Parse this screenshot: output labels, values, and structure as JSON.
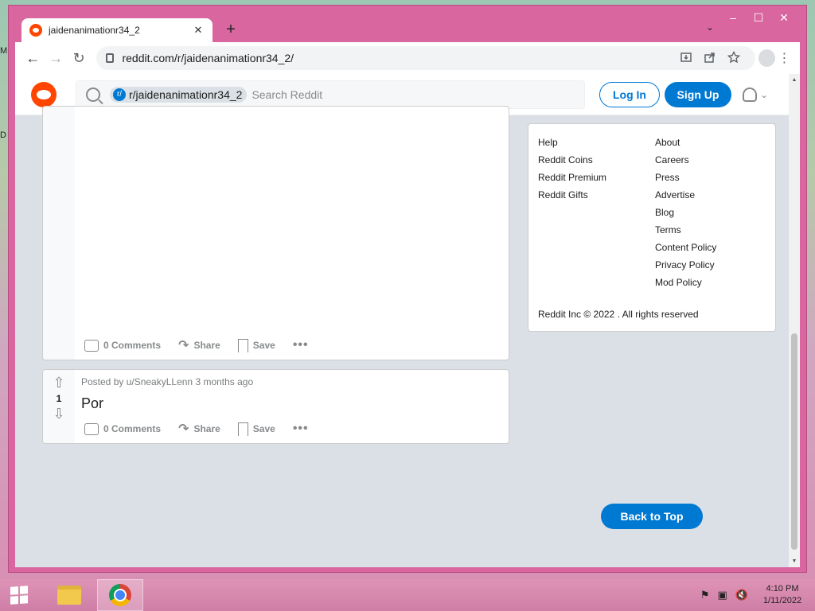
{
  "desktop": {
    "glyph1": "M",
    "glyph2": "D"
  },
  "window": {
    "minimize": "–",
    "maximize": "☐",
    "close": "✕"
  },
  "tab": {
    "title": "jaidenanimationr34_2",
    "close": "✕",
    "new_tab": "+",
    "tab_menu": "⌄"
  },
  "toolbar": {
    "back": "←",
    "forward": "→",
    "reload": "↻",
    "url": "reddit.com/r/jaidenanimationr34_2/",
    "menu": "⋮"
  },
  "reddit": {
    "subreddit_chip": "r/jaidenanimationr34_2",
    "subreddit_chip_icon": "r/",
    "search_placeholder": "Search Reddit",
    "login": "Log In",
    "signup": "Sign Up"
  },
  "posts": [
    {
      "comments": "0 Comments",
      "share": "Share",
      "save": "Save",
      "more": "•••"
    },
    {
      "posted_by": "Posted by u/SneakyLLenn 3 months ago",
      "votes": "1",
      "title": "Por",
      "comments": "0 Comments",
      "share": "Share",
      "save": "Save",
      "more": "•••"
    }
  ],
  "footer": {
    "col1": [
      "Help",
      "Reddit Coins",
      "Reddit Premium",
      "Reddit Gifts"
    ],
    "col2": [
      "About",
      "Careers",
      "Press",
      "Advertise",
      "Blog",
      "Terms",
      "Content Policy",
      "Privacy Policy",
      "Mod Policy"
    ],
    "copyright": "Reddit Inc © 2022 . All rights reserved",
    "back_to_top": "Back to Top"
  },
  "taskbar": {
    "time": "4:10 PM",
    "date": "1/11/2022"
  },
  "colors": {
    "reddit_orange": "#ff4500",
    "reddit_blue": "#0079d3",
    "window_frame": "#d9669f"
  }
}
